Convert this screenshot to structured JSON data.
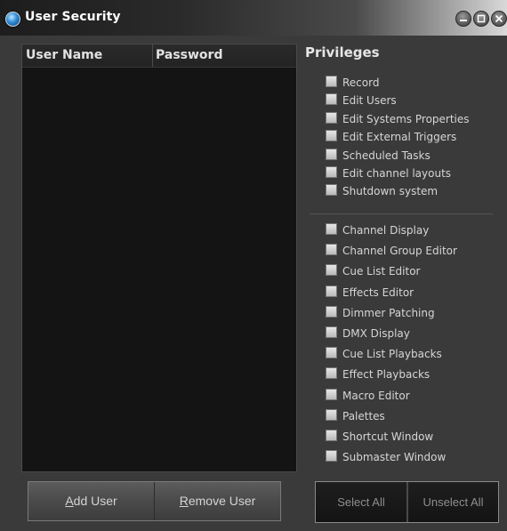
{
  "window": {
    "title": "User Security",
    "controls": [
      "minimize-icon",
      "maximize-icon",
      "close-icon"
    ]
  },
  "user_list": {
    "columns": [
      "User Name",
      "Password"
    ],
    "rows": []
  },
  "buttons": {
    "add_user": {
      "underlined": "A",
      "rest": "dd User"
    },
    "remove_user": {
      "underlined": "R",
      "rest": "emove User"
    },
    "select_all": "Select All",
    "unselect_all": "Unselect All"
  },
  "privileges": {
    "title": "Privileges",
    "group1": [
      "Record",
      "Edit Users",
      "Edit Systems Properties",
      "Edit External Triggers",
      "Scheduled Tasks",
      "Edit channel layouts",
      "Shutdown system"
    ],
    "group2": [
      "Channel Display",
      "Channel Group Editor",
      "Cue List Editor",
      "Effects Editor",
      "Dimmer Patching",
      "DMX Display",
      "Cue List Playbacks",
      "Effect Playbacks",
      "Macro Editor",
      "Palettes",
      "Shortcut Window",
      "Submaster Window"
    ]
  }
}
